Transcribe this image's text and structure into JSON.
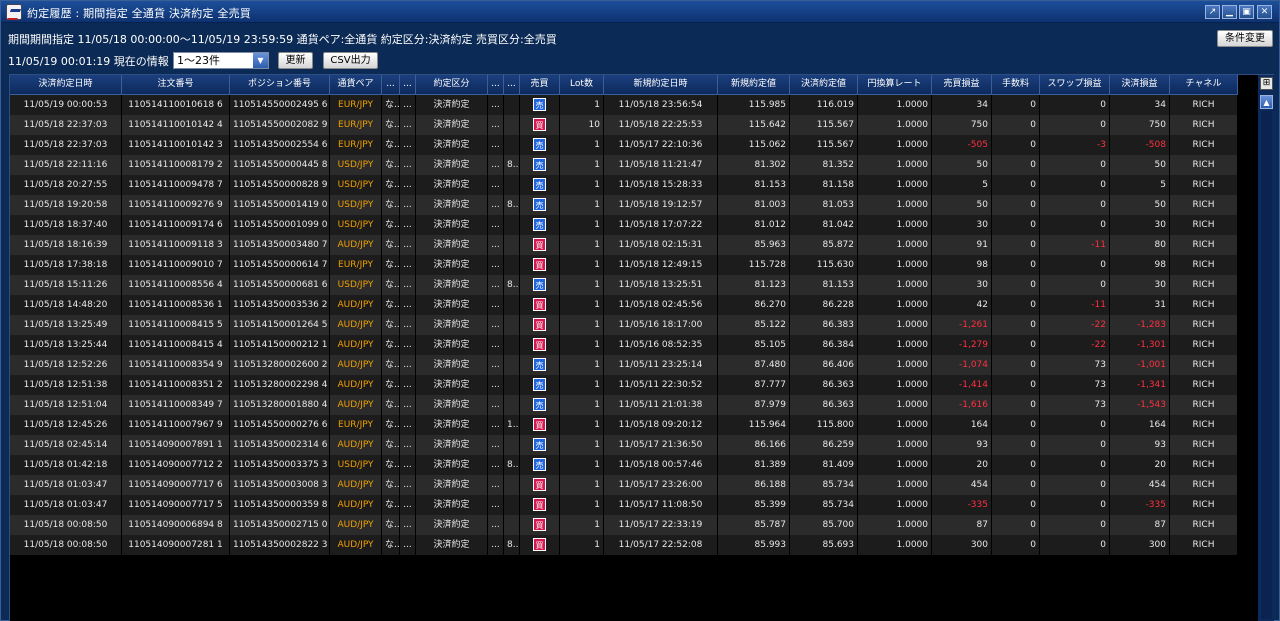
{
  "window": {
    "title": "約定履歴 : 期間指定 全通貨 決済約定 全売買",
    "pin_glyph": "↗",
    "min_glyph": "▁",
    "max_glyph": "▣",
    "close_glyph": "✕"
  },
  "filter_summary": "期間期間指定  11/05/18 00:00:00〜11/05/19 23:59:59   通貨ペア:全通貨   約定区分:決済約定   売買区分:全売買",
  "current_info": "11/05/19 00:01:19 現在の情報",
  "range_select": {
    "value": "1〜23件",
    "arrow": "▼"
  },
  "buttons": {
    "refresh": "更新",
    "csv": "CSV出力",
    "conditions": "条件変更"
  },
  "grid": {
    "col_chooser_glyph": "⊞",
    "scroll_up_glyph": "▲",
    "headers": [
      "決済約定日時",
      "注文番号",
      "ポジション番号",
      "通貨ペア",
      "...",
      "...",
      "約定区分",
      "...",
      "...",
      "売買",
      "Lot数",
      "新規約定日時",
      "新規約定値",
      "決済約定値",
      "円換算レート",
      "売買損益",
      "手数料",
      "スワップ損益",
      "決済損益",
      "チャネル"
    ],
    "rows": [
      [
        "11/05/19 00:00:53",
        "110514110010618 6",
        "110514550002495 6",
        "EUR/JPY",
        "な...",
        "...",
        "決済約定",
        "...",
        "",
        "売",
        "1",
        "11/05/18 23:56:54",
        "115.985",
        "116.019",
        "1.0000",
        "34",
        "0",
        "0",
        "34",
        "RICH"
      ],
      [
        "11/05/18 22:37:03",
        "110514110010142 4",
        "110514550002082 9",
        "EUR/JPY",
        "な...",
        "...",
        "決済約定",
        "...",
        "",
        "買",
        "10",
        "11/05/18 22:25:53",
        "115.642",
        "115.567",
        "1.0000",
        "750",
        "0",
        "0",
        "750",
        "RICH"
      ],
      [
        "11/05/18 22:37:03",
        "110514110010142 3",
        "110514350002554 6",
        "EUR/JPY",
        "な...",
        "...",
        "決済約定",
        "...",
        "",
        "売",
        "1",
        "11/05/17 22:10:36",
        "115.062",
        "115.567",
        "1.0000",
        "-505",
        "0",
        "-3",
        "-508",
        "RICH"
      ],
      [
        "11/05/18 22:11:16",
        "110514110008179 2",
        "110514550000445 8",
        "USD/JPY",
        "な...",
        "...",
        "決済約定",
        "...",
        "8...",
        "売",
        "1",
        "11/05/18 11:21:47",
        "81.302",
        "81.352",
        "1.0000",
        "50",
        "0",
        "0",
        "50",
        "RICH"
      ],
      [
        "11/05/18 20:27:55",
        "110514110009478 7",
        "110514550000828 9",
        "USD/JPY",
        "な...",
        "...",
        "決済約定",
        "...",
        "",
        "売",
        "1",
        "11/05/18 15:28:33",
        "81.153",
        "81.158",
        "1.0000",
        "5",
        "0",
        "0",
        "5",
        "RICH"
      ],
      [
        "11/05/18 19:20:58",
        "110514110009276 9",
        "110514550001419 0",
        "USD/JPY",
        "な...",
        "...",
        "決済約定",
        "...",
        "8...",
        "売",
        "1",
        "11/05/18 19:12:57",
        "81.003",
        "81.053",
        "1.0000",
        "50",
        "0",
        "0",
        "50",
        "RICH"
      ],
      [
        "11/05/18 18:37:40",
        "110514110009174 6",
        "110514550001099 0",
        "USD/JPY",
        "な...",
        "...",
        "決済約定",
        "...",
        "",
        "売",
        "1",
        "11/05/18 17:07:22",
        "81.012",
        "81.042",
        "1.0000",
        "30",
        "0",
        "0",
        "30",
        "RICH"
      ],
      [
        "11/05/18 18:16:39",
        "110514110009118 3",
        "110514350003480 7",
        "AUD/JPY",
        "な...",
        "...",
        "決済約定",
        "...",
        "",
        "買",
        "1",
        "11/05/18 02:15:31",
        "85.963",
        "85.872",
        "1.0000",
        "91",
        "0",
        "-11",
        "80",
        "RICH"
      ],
      [
        "11/05/18 17:38:18",
        "110514110009010 7",
        "110514550000614 7",
        "EUR/JPY",
        "な...",
        "...",
        "決済約定",
        "...",
        "",
        "買",
        "1",
        "11/05/18 12:49:15",
        "115.728",
        "115.630",
        "1.0000",
        "98",
        "0",
        "0",
        "98",
        "RICH"
      ],
      [
        "11/05/18 15:11:26",
        "110514110008556 4",
        "110514550000681 6",
        "USD/JPY",
        "な...",
        "...",
        "決済約定",
        "...",
        "8...",
        "売",
        "1",
        "11/05/18 13:25:51",
        "81.123",
        "81.153",
        "1.0000",
        "30",
        "0",
        "0",
        "30",
        "RICH"
      ],
      [
        "11/05/18 14:48:20",
        "110514110008536 1",
        "110514350003536 2",
        "AUD/JPY",
        "な...",
        "...",
        "決済約定",
        "...",
        "",
        "買",
        "1",
        "11/05/18 02:45:56",
        "86.270",
        "86.228",
        "1.0000",
        "42",
        "0",
        "-11",
        "31",
        "RICH"
      ],
      [
        "11/05/18 13:25:49",
        "110514110008415 5",
        "110514150001264 5",
        "AUD/JPY",
        "な...",
        "...",
        "決済約定",
        "...",
        "",
        "買",
        "1",
        "11/05/16 18:17:00",
        "85.122",
        "86.383",
        "1.0000",
        "-1,261",
        "0",
        "-22",
        "-1,283",
        "RICH"
      ],
      [
        "11/05/18 13:25:44",
        "110514110008415 4",
        "110514150000212 1",
        "AUD/JPY",
        "な...",
        "...",
        "決済約定",
        "...",
        "",
        "買",
        "1",
        "11/05/16 08:52:35",
        "85.105",
        "86.384",
        "1.0000",
        "-1,279",
        "0",
        "-22",
        "-1,301",
        "RICH"
      ],
      [
        "11/05/18 12:52:26",
        "110514110008354 9",
        "110513280002600 2",
        "AUD/JPY",
        "な...",
        "...",
        "決済約定",
        "...",
        "",
        "売",
        "1",
        "11/05/11 23:25:14",
        "87.480",
        "86.406",
        "1.0000",
        "-1,074",
        "0",
        "73",
        "-1,001",
        "RICH"
      ],
      [
        "11/05/18 12:51:38",
        "110514110008351 2",
        "110513280002298 4",
        "AUD/JPY",
        "な...",
        "...",
        "決済約定",
        "...",
        "",
        "売",
        "1",
        "11/05/11 22:30:52",
        "87.777",
        "86.363",
        "1.0000",
        "-1,414",
        "0",
        "73",
        "-1,341",
        "RICH"
      ],
      [
        "11/05/18 12:51:04",
        "110514110008349 7",
        "110513280001880 4",
        "AUD/JPY",
        "な...",
        "...",
        "決済約定",
        "...",
        "",
        "売",
        "1",
        "11/05/11 21:01:38",
        "87.979",
        "86.363",
        "1.0000",
        "-1,616",
        "0",
        "73",
        "-1,543",
        "RICH"
      ],
      [
        "11/05/18 12:45:26",
        "110514110007967 9",
        "110514550000276 6",
        "EUR/JPY",
        "な...",
        "...",
        "決済約定",
        "...",
        "1...",
        "買",
        "1",
        "11/05/18 09:20:12",
        "115.964",
        "115.800",
        "1.0000",
        "164",
        "0",
        "0",
        "164",
        "RICH"
      ],
      [
        "11/05/18 02:45:14",
        "110514090007891 1",
        "110514350002314 6",
        "AUD/JPY",
        "な...",
        "...",
        "決済約定",
        "...",
        "",
        "売",
        "1",
        "11/05/17 21:36:50",
        "86.166",
        "86.259",
        "1.0000",
        "93",
        "0",
        "0",
        "93",
        "RICH"
      ],
      [
        "11/05/18 01:42:18",
        "110514090007712 2",
        "110514350003375 3",
        "USD/JPY",
        "な...",
        "...",
        "決済約定",
        "...",
        "8...",
        "売",
        "1",
        "11/05/18 00:57:46",
        "81.389",
        "81.409",
        "1.0000",
        "20",
        "0",
        "0",
        "20",
        "RICH"
      ],
      [
        "11/05/18 01:03:47",
        "110514090007717 6",
        "110514350003008 3",
        "AUD/JPY",
        "な...",
        "...",
        "決済約定",
        "...",
        "",
        "買",
        "1",
        "11/05/17 23:26:00",
        "86.188",
        "85.734",
        "1.0000",
        "454",
        "0",
        "0",
        "454",
        "RICH"
      ],
      [
        "11/05/18 01:03:47",
        "110514090007717 5",
        "110514350000359 8",
        "AUD/JPY",
        "な...",
        "...",
        "決済約定",
        "...",
        "",
        "買",
        "1",
        "11/05/17 11:08:50",
        "85.399",
        "85.734",
        "1.0000",
        "-335",
        "0",
        "0",
        "-335",
        "RICH"
      ],
      [
        "11/05/18 00:08:50",
        "110514090006894 8",
        "110514350002715 0",
        "AUD/JPY",
        "な...",
        "...",
        "決済約定",
        "...",
        "",
        "買",
        "1",
        "11/05/17 22:33:19",
        "85.787",
        "85.700",
        "1.0000",
        "87",
        "0",
        "0",
        "87",
        "RICH"
      ],
      [
        "11/05/18 00:08:50",
        "110514090007281 1",
        "110514350002822 3",
        "AUD/JPY",
        "な...",
        "...",
        "決済約定",
        "...",
        "8...",
        "買",
        "1",
        "11/05/17 22:52:08",
        "85.993",
        "85.693",
        "1.0000",
        "300",
        "0",
        "0",
        "300",
        "RICH"
      ]
    ]
  },
  "colors": {
    "sell_badge": "#2266dd",
    "buy_badge": "#d21a50",
    "negative": "#ff3040",
    "pair_text": "#f0a000"
  }
}
